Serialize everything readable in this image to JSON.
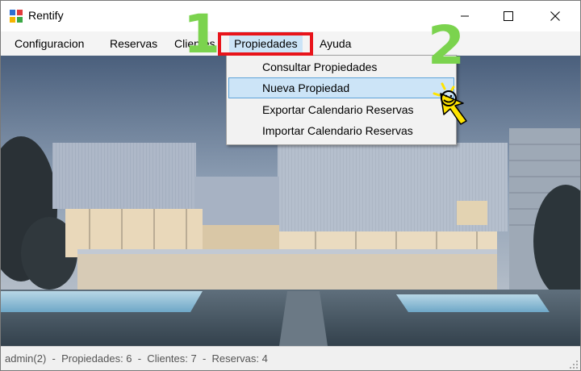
{
  "window": {
    "title": "Rentify"
  },
  "menu": {
    "items": [
      {
        "label": "Configuracion"
      },
      {
        "label": "Reservas"
      },
      {
        "label": "Clientes"
      },
      {
        "label": "Propiedades"
      },
      {
        "label": "Ayuda"
      }
    ],
    "open_menu": "Propiedades"
  },
  "dropdown": {
    "items": [
      {
        "label": "Consultar Propiedades"
      },
      {
        "label": "Nueva Propiedad"
      },
      {
        "label": "Exportar Calendario Reservas"
      },
      {
        "label": "Importar Calendario Reservas"
      }
    ],
    "highlighted": "Nueva Propiedad"
  },
  "annotations": {
    "step1": "1",
    "step2": "2",
    "step_color": "#7bd34e",
    "highlight_color": "#e8141b"
  },
  "statusbar": {
    "text": "admin(2)  -  Propiedades: 6  -  Clientes: 7  -  Reservas: 4"
  },
  "background": {
    "description_icon": "modern-house-image"
  },
  "colors": {
    "menu_hover": "#cce4f7",
    "menu_hover_border": "#5ea3d9",
    "cursor": "#ffe400"
  }
}
